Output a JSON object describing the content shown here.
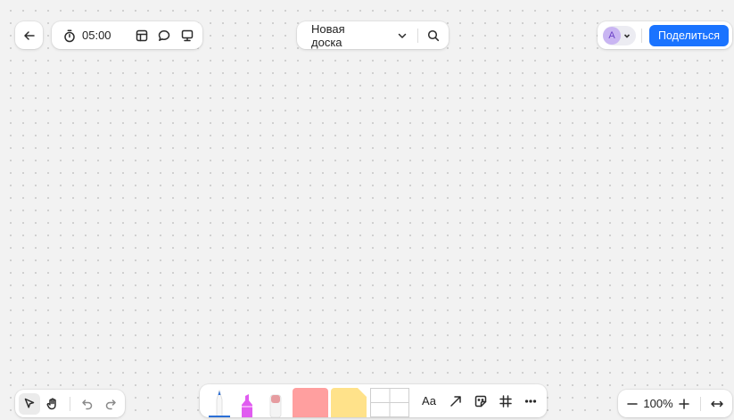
{
  "header": {
    "back_icon": "arrow-left-icon",
    "timer": {
      "icon": "stopwatch-icon",
      "value": "05:00"
    },
    "actions": [
      "layout-template-icon",
      "comment-icon",
      "presentation-icon"
    ],
    "board_title": "Новая доска",
    "board_menu_icon": "chevron-down-icon",
    "search_icon": "search-icon",
    "avatar_initial": "A",
    "share_label": "Поделиться"
  },
  "colors": {
    "accent": "#1a73ff",
    "avatar_bg": "#c9b5f2",
    "shape_fill": "#ff9f9f",
    "sticky_fill": "#ffe28a",
    "marker": "#e05cf0"
  },
  "navigation": {
    "tools": [
      "cursor-select-icon",
      "hand-pan-icon",
      "undo-icon",
      "redo-icon"
    ]
  },
  "toolbar": {
    "draw_tools": [
      "pen-icon",
      "marker-icon",
      "eraser-icon"
    ],
    "insert_tools": [
      "shape-tool",
      "sticky-note-tool",
      "table-tool"
    ],
    "text_label": "Aa",
    "more_tools": [
      "arrow-icon",
      "sticker-icon",
      "frame-icon",
      "more-icon"
    ]
  },
  "zoom": {
    "value": "100%",
    "fit_icon": "fit-width-icon"
  }
}
